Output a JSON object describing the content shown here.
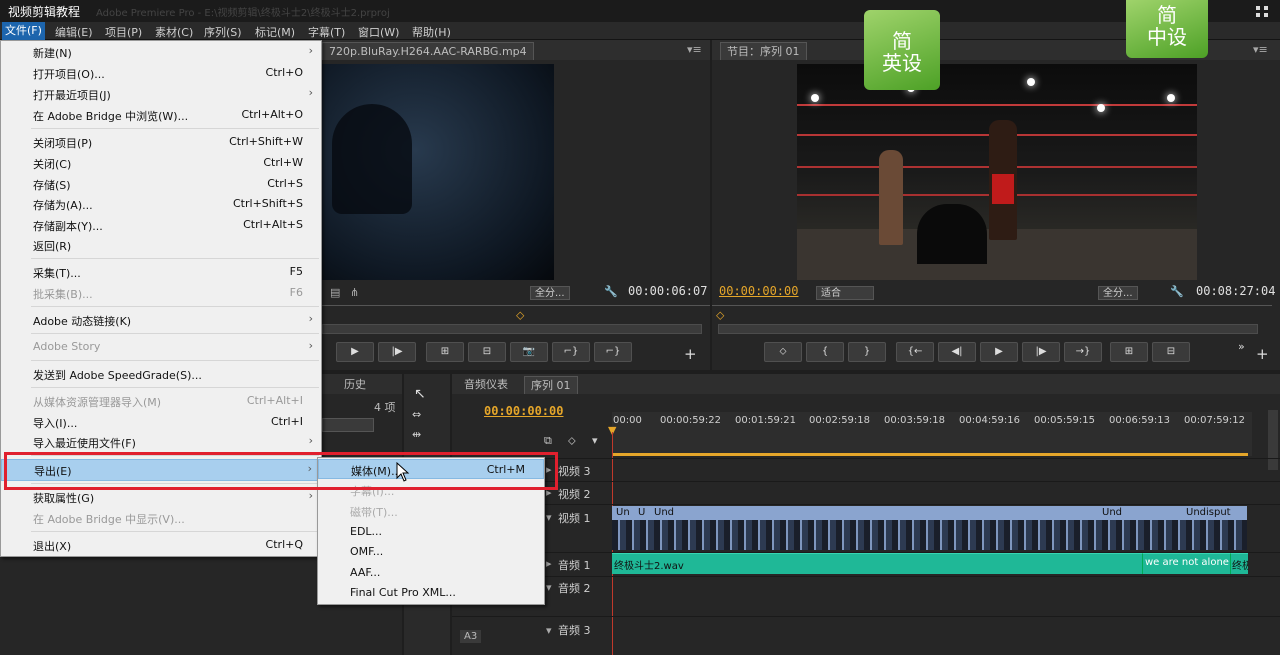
{
  "window": {
    "title": "视频剪辑教程",
    "path": "Adobe Premiere Pro - E:\\视频剪辑\\终极斗士2\\终极斗士2.prproj"
  },
  "menubar": [
    "文件(F)",
    "编辑(E)",
    "项目(P)",
    "素材(C)",
    "序列(S)",
    "标记(M)",
    "字幕(T)",
    "窗口(W)",
    "帮助(H)"
  ],
  "file_menu": {
    "items": [
      {
        "label": "新建(N)",
        "shortcut": "",
        "arrow": "›"
      },
      {
        "label": "打开项目(O)...",
        "shortcut": "Ctrl+O",
        "arrow": ""
      },
      {
        "label": "打开最近项目(J)",
        "shortcut": "",
        "arrow": "›"
      },
      {
        "label": "在 Adobe Bridge 中浏览(W)...",
        "shortcut": "Ctrl+Alt+O",
        "arrow": ""
      },
      {
        "label": "关闭项目(P)",
        "shortcut": "Ctrl+Shift+W",
        "arrow": ""
      },
      {
        "label": "关闭(C)",
        "shortcut": "Ctrl+W",
        "arrow": ""
      },
      {
        "label": "存储(S)",
        "shortcut": "Ctrl+S",
        "arrow": ""
      },
      {
        "label": "存储为(A)...",
        "shortcut": "Ctrl+Shift+S",
        "arrow": ""
      },
      {
        "label": "存储副本(Y)...",
        "shortcut": "Ctrl+Alt+S",
        "arrow": ""
      },
      {
        "label": "返回(R)",
        "shortcut": "",
        "arrow": ""
      },
      {
        "label": "采集(T)...",
        "shortcut": "F5",
        "arrow": ""
      },
      {
        "label": "批采集(B)...",
        "shortcut": "F6",
        "arrow": ""
      },
      {
        "label": "Adobe 动态链接(K)",
        "shortcut": "",
        "arrow": "›"
      },
      {
        "label": "Adobe Story",
        "shortcut": "",
        "arrow": "›"
      },
      {
        "label": "发送到 Adobe SpeedGrade(S)...",
        "shortcut": "",
        "arrow": ""
      },
      {
        "label": "从媒体资源管理器导入(M)",
        "shortcut": "Ctrl+Alt+I",
        "arrow": ""
      },
      {
        "label": "导入(I)...",
        "shortcut": "Ctrl+I",
        "arrow": ""
      },
      {
        "label": "导入最近使用文件(F)",
        "shortcut": "",
        "arrow": "›"
      },
      {
        "label": "导出(E)",
        "shortcut": "",
        "arrow": "›"
      },
      {
        "label": "获取属性(G)",
        "shortcut": "",
        "arrow": "›"
      },
      {
        "label": "在 Adobe Bridge 中显示(V)...",
        "shortcut": "",
        "arrow": ""
      },
      {
        "label": "退出(X)",
        "shortcut": "Ctrl+Q",
        "arrow": ""
      }
    ]
  },
  "export_submenu": [
    {
      "label": "媒体(M)...",
      "shortcut": "Ctrl+M"
    },
    {
      "label": "字幕(I)...",
      "shortcut": ""
    },
    {
      "label": "磁带(T)...",
      "shortcut": ""
    },
    {
      "label": "EDL...",
      "shortcut": ""
    },
    {
      "label": "OMF...",
      "shortcut": ""
    },
    {
      "label": "AAF...",
      "shortcut": ""
    },
    {
      "label": "Final Cut Pro XML...",
      "shortcut": ""
    }
  ],
  "source_monitor": {
    "tab": "720p.BluRay.H264.AAC-RARBG.mp4",
    "fit": "全分...",
    "timecode": "00:00:06:07"
  },
  "program_monitor": {
    "tab": "节目：序列 01",
    "timecode_left": "00:00:00:00",
    "fit": "适合",
    "res": "全分...",
    "timecode_right": "00:08:27:04"
  },
  "project_panel": {
    "tab": "历史",
    "count": "4 项"
  },
  "timeline": {
    "tabs": [
      "音频仪表",
      "序列 01"
    ],
    "timecode": "00:00:00:00",
    "ruler": [
      "00:00",
      "00:00:59:22",
      "00:01:59:21",
      "00:02:59:18",
      "00:03:59:18",
      "00:04:59:16",
      "00:05:59:15",
      "00:06:59:13",
      "00:07:59:12"
    ],
    "tracks": [
      "视频 3",
      "视频 2",
      "视频 1",
      "音频 1",
      "音频 2",
      "音频 3"
    ],
    "clip_labels": [
      "Un",
      "U",
      "Und",
      "Und",
      "Undisput"
    ],
    "audio_clips": [
      "终极斗士2.wav",
      "we are not alone",
      "终极"
    ],
    "track_a3": "A3"
  },
  "logos": [
    {
      "line1": "简",
      "line2": "英设"
    },
    {
      "line1": "简",
      "line2": "中设"
    }
  ]
}
